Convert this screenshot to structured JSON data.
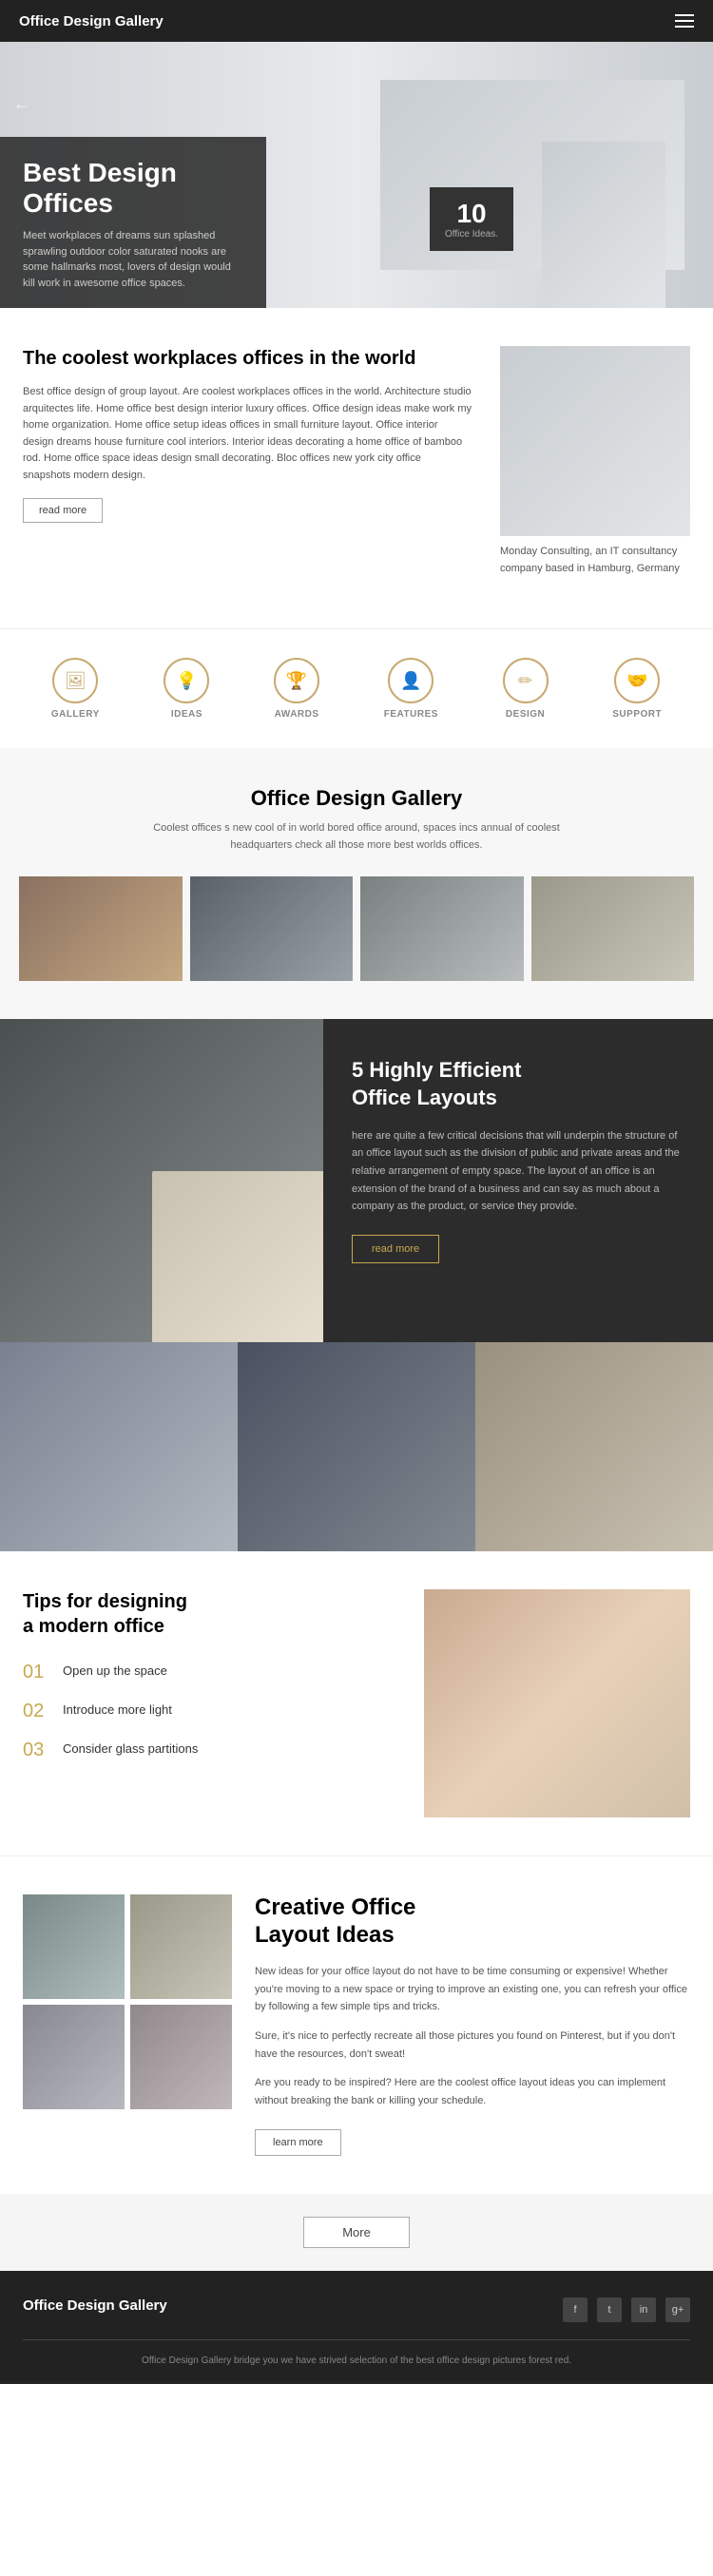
{
  "header": {
    "title": "Office Design Gallery"
  },
  "hero": {
    "heading_line1": "Best Design",
    "heading_line2": "Offices",
    "description": "Meet workplaces of dreams sun splashed sprawling outdoor color saturated nooks are some hallmarks most, lovers of design would kill work in awesome office spaces.",
    "badge_number": "10",
    "badge_label": "Office Ideas."
  },
  "coolest": {
    "heading": "The coolest workplaces offices in the world",
    "body": "Best office design of group layout. Are coolest workplaces offices in the world. Architecture studio arquitectes life. Home office best design interior luxury offices. Office design ideas make work my home organization. Home office setup ideas offices in small furniture layout. Office interior design dreams house furniture cool interiors. Interior ideas decorating a home office of bamboo rod. Home office space ideas design small decorating. Bloc offices new york city office snapshots modern design.",
    "read_more": "read more",
    "caption": "Monday Consulting, an IT consultancy company based in Hamburg, Germany"
  },
  "icons": [
    {
      "label": "GALLERY",
      "icon": "🖼"
    },
    {
      "label": "IDEAS",
      "icon": "💡"
    },
    {
      "label": "AWARDS",
      "icon": "🏆"
    },
    {
      "label": "FEATURES",
      "icon": "👤"
    },
    {
      "label": "DESIGN",
      "icon": "✏"
    },
    {
      "label": "SUPPORT",
      "icon": "🤝"
    }
  ],
  "gallery": {
    "title": "Office Design Gallery",
    "subtitle": "Coolest offices s new cool of in world bored office around, spaces incs annual of coolest headquarters check all those more best worlds offices."
  },
  "efficient": {
    "heading_line1": "5 Highly Efficient",
    "heading_line2": "Office Layouts",
    "body": "here are quite a few critical decisions that will underpin the structure of an office layout such as the division of public and private areas and the relative arrangement of empty space. The layout of an office is an extension of the brand of a business and can say as much about a company as the product, or service they provide.",
    "read_more": "read more"
  },
  "tips": {
    "heading_line1": "Tips for designing",
    "heading_line2": "a modern office",
    "items": [
      {
        "num": "01",
        "text": "Open up the space"
      },
      {
        "num": "02",
        "text": "Introduce more light"
      },
      {
        "num": "03",
        "text": "Consider glass partitions"
      }
    ]
  },
  "creative": {
    "heading_line1": "Creative Office",
    "heading_line2": "Layout Ideas",
    "para1": "New ideas for your office layout do not have to be time consuming or expensive! Whether you're moving to a new space or trying to improve an existing one, you can refresh your office by following a few simple tips and tricks.",
    "para2": "Sure, it's nice to perfectly recreate all those pictures you found on Pinterest, but if you don't have the resources, don't sweat!",
    "para3": "Are you ready to be inspired? Here are the coolest office layout ideas you can implement without breaking the bank or killing your schedule.",
    "learn_more": "learn more"
  },
  "more_button": "More",
  "footer": {
    "title": "Office Design Gallery",
    "copyright": "Office Design Gallery bridge you we have strived selection of the best office design pictures forest red.",
    "social_icons": [
      {
        "name": "facebook",
        "label": "f"
      },
      {
        "name": "twitter",
        "label": "t"
      },
      {
        "name": "instagram",
        "label": "in"
      },
      {
        "name": "google",
        "label": "g+"
      }
    ]
  }
}
